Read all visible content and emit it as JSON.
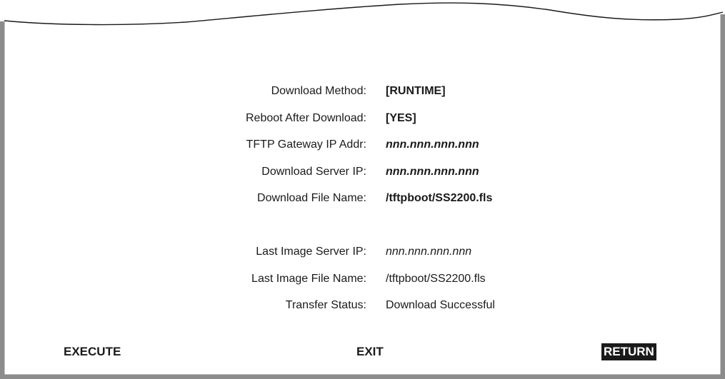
{
  "screen": {
    "fields": [
      {
        "label": "Download Method:",
        "value": "[RUNTIME]"
      },
      {
        "label": "Reboot After Download:",
        "value": "[YES]"
      },
      {
        "label": "TFTP Gateway IP Addr:",
        "value": "nnn.nnn.nnn.nnn"
      },
      {
        "label": "Download Server IP:",
        "value": "nnn.nnn.nnn.nnn"
      },
      {
        "label": "Download File Name:",
        "value": "/tftpboot/SS2200.fls"
      }
    ],
    "status": [
      {
        "label": "Last Image Server IP:",
        "value": "nnn.nnn.nnn.nnn"
      },
      {
        "label": "Last Image File Name:",
        "value": "/tftpboot/SS2200.fls"
      },
      {
        "label": "Transfer Status:",
        "value": "Download Successful"
      }
    ],
    "actions": {
      "execute": "EXECUTE",
      "exit": "EXIT",
      "return": "RETURN",
      "selected": "return"
    }
  },
  "colors": {
    "frame": "#8c8c8c",
    "text": "#1a1a1a",
    "highlight_bg": "#1a1a1a",
    "highlight_text": "#ffffff"
  }
}
